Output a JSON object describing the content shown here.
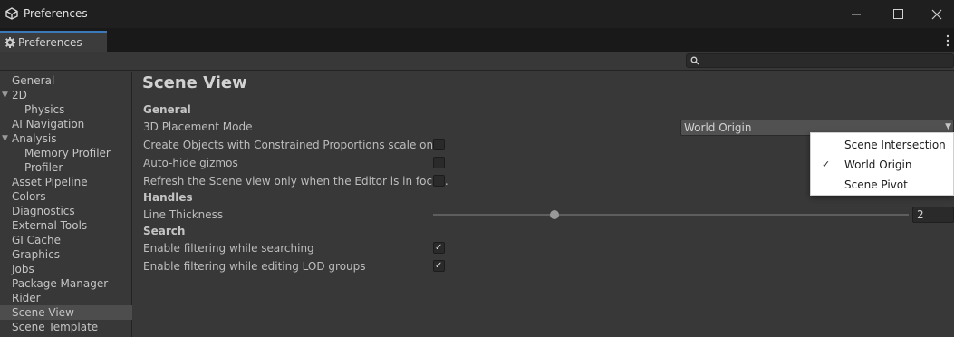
{
  "window": {
    "title": "Preferences"
  },
  "tab": {
    "label": "Preferences"
  },
  "search": {
    "placeholder": "",
    "value": ""
  },
  "sidebar": {
    "items": [
      {
        "label": "General"
      },
      {
        "label": "2D"
      },
      {
        "label": "Physics"
      },
      {
        "label": "AI Navigation"
      },
      {
        "label": "Analysis"
      },
      {
        "label": "Memory Profiler"
      },
      {
        "label": "Profiler"
      },
      {
        "label": "Asset Pipeline"
      },
      {
        "label": "Colors"
      },
      {
        "label": "Diagnostics"
      },
      {
        "label": "External Tools"
      },
      {
        "label": "GI Cache"
      },
      {
        "label": "Graphics"
      },
      {
        "label": "Jobs"
      },
      {
        "label": "Package Manager"
      },
      {
        "label": "Rider"
      },
      {
        "label": "Scene View"
      },
      {
        "label": "Scene Template"
      }
    ],
    "selected": "Scene View"
  },
  "main": {
    "title": "Scene View",
    "general": {
      "heading": "General",
      "placement_mode_label": "3D Placement Mode",
      "placement_mode_value": "World Origin",
      "constrained_label": "Create Objects with Constrained Proportions scale on",
      "constrained_checked": false,
      "autohide_label": "Auto-hide gizmos",
      "autohide_checked": false,
      "refresh_label": "Refresh the Scene view only when the Editor is in focus.",
      "refresh_checked": false
    },
    "handles": {
      "heading": "Handles",
      "line_thickness_label": "Line Thickness",
      "line_thickness_value": "2"
    },
    "search": {
      "heading": "Search",
      "filter_searching_label": "Enable filtering while searching",
      "filter_searching_checked": true,
      "filter_lod_label": "Enable filtering while editing LOD groups",
      "filter_lod_checked": true
    }
  },
  "popup": {
    "options": [
      {
        "label": "Scene Intersection",
        "checked": false
      },
      {
        "label": "World Origin",
        "checked": true
      },
      {
        "label": "Scene Pivot",
        "checked": false
      }
    ]
  },
  "icons": {
    "check_glyph": "✓",
    "expand_glyph": "▼"
  }
}
